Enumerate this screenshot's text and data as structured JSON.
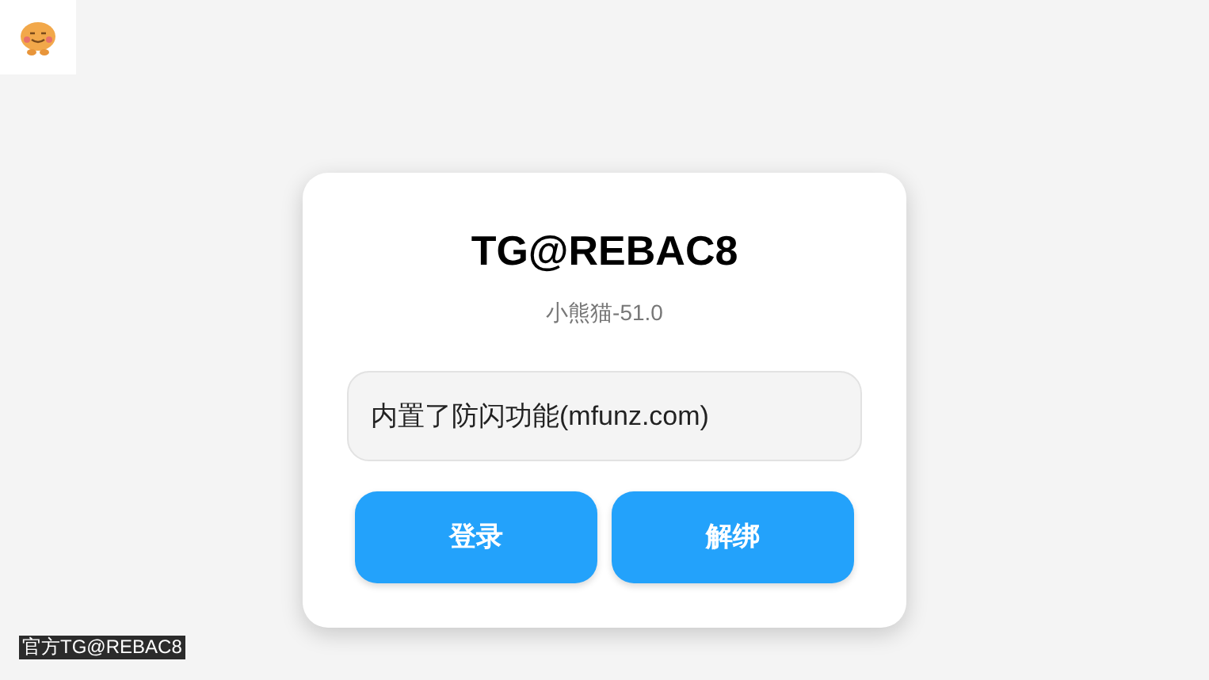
{
  "card": {
    "title": "TG@REBAC8",
    "subtitle": "小熊猫-51.0",
    "field": {
      "value": "内置了防闪功能(mfunz.com)"
    },
    "buttons": [
      "登录",
      "解绑"
    ]
  },
  "footer_label": "官方TG@REBAC8"
}
